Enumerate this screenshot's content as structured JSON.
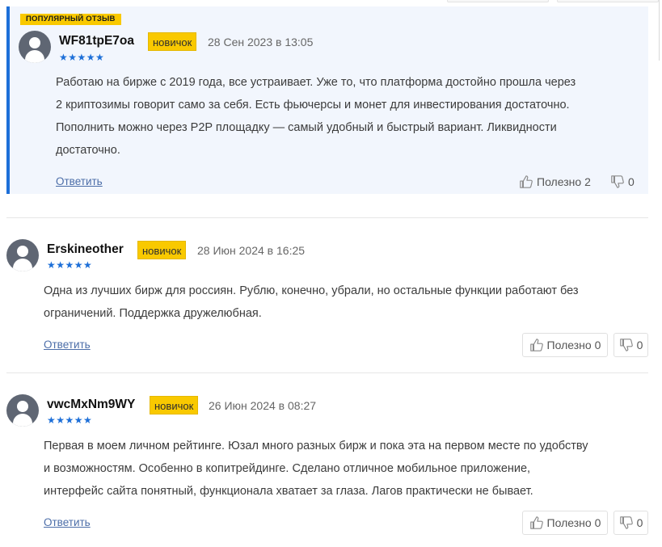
{
  "popular_badge": "ПОПУЛЯРНЫЙ ОТЗЫВ",
  "reviews": [
    {
      "username": "WF81tpE7oa",
      "role": "новичок",
      "date": "28 Сен 2023 в 13:05",
      "stars": "★★★★★",
      "rating": 5,
      "lines": [
        "Работаю на бирже с 2019 года, все устраивает. Уже то, что платформа достойно прошла через",
        "2 криптозимы говорит само за себя. Есть фьючерсы и монет для инвестирования достаточно.",
        "Пополнить можно через P2P площадку — самый удобный и быстрый вариант. Ликвидности",
        "достаточно."
      ],
      "reply_label": "Ответить",
      "useful_label": "Полезно",
      "useful_count": "2",
      "dislike_count": "0"
    },
    {
      "username": "Erskineother",
      "role": "новичок",
      "date": "28 Июн 2024 в 16:25",
      "stars": "★★★★★",
      "rating": 5,
      "lines": [
        "Одна из лучших бирж для россиян. Рублю, конечно, убрали, но остальные функции работают без",
        "ограничений. Поддержка дружелюбная."
      ],
      "reply_label": "Ответить",
      "useful_label": "Полезно",
      "useful_count": "0",
      "dislike_count": "0"
    },
    {
      "username": "vwcMxNm9WY",
      "role": "новичок",
      "date": "26 Июн 2024 в 08:27",
      "stars": "★★★★★",
      "rating": 5,
      "lines": [
        "Первая в моем личном рейтинге. Юзал много разных бирж и пока эта на первом месте по удобству",
        "и возможностям. Особенно в копитрейдинге. Сделано отличное мобильное приложение,",
        "интерфейс сайта понятный, функционала хватает за глаза. Лагов практически не бывает."
      ],
      "reply_label": "Ответить",
      "useful_label": "Полезно",
      "useful_count": "0",
      "dislike_count": "0"
    }
  ],
  "colors": {
    "accent": "#1d6fd8",
    "badge": "#f9c900",
    "popular_bg": "#f2f6fd",
    "link": "#4b6da8"
  }
}
